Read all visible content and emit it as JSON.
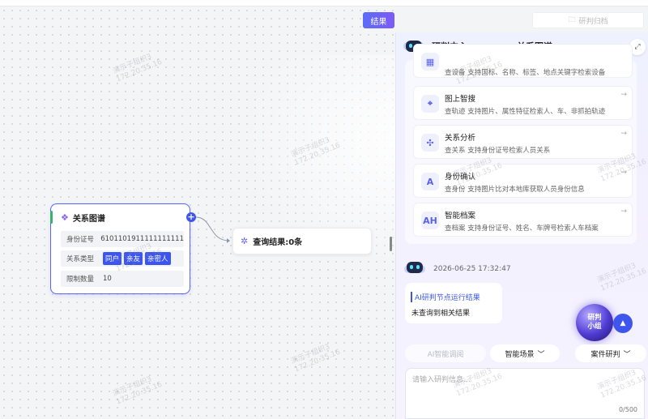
{
  "top": {
    "corner_text": ""
  },
  "toolbar": {
    "result_label": "结果",
    "archive_label": "研判归档",
    "archive_icon": "folder-icon"
  },
  "node": {
    "title": "关系图谱",
    "icon": "graph-icon",
    "rows": [
      {
        "label": "身份证号",
        "value": "6101101911111111111"
      },
      {
        "label": "关系类型",
        "tags": [
          "同户",
          "亲友",
          "亲密人"
        ]
      },
      {
        "label": "限制数量",
        "value": "10"
      }
    ],
    "plus": "+"
  },
  "result_node": {
    "label": "查询结果:0条"
  },
  "panel": {
    "tabs": [
      "研判中心",
      "关系图谱"
    ],
    "expand_icon": "expand-icon",
    "cards": [
      {
        "icon": "device-icon",
        "title": "",
        "desc": "查设备 支持国标、名称、标签、地点关键字检索设备",
        "glyph": "▦"
      },
      {
        "icon": "image-search-icon",
        "title": "图上智搜",
        "desc": "查轨迹 支持图片、属性特征检索人、车、非抓拍轨迹",
        "glyph": "⌖"
      },
      {
        "icon": "relation-icon",
        "title": "关系分析",
        "desc": "查关系 支持身份证号检索人员关系",
        "glyph": "✣"
      },
      {
        "icon": "identity-icon",
        "title": "身份确认",
        "desc": "查身份 支持图片比对本地库获取人员身份信息",
        "glyph": "A"
      },
      {
        "icon": "archive-icon",
        "title": "智能档案",
        "desc": "查档案 支持身份证号、姓名、车牌号检索人车档案",
        "glyph": "AH"
      }
    ],
    "message": {
      "time": "2026-06-25 17:32:47",
      "title": "AI研判节点运行结果",
      "text": "未查询到相关结果"
    },
    "orb": {
      "line1": "研判",
      "line2": "小组"
    },
    "chips": [
      {
        "label": "AI智能调阅",
        "disabled": true
      },
      {
        "label": "智能场景",
        "disabled": false
      },
      {
        "label": "案件研判",
        "disabled": false
      }
    ],
    "input": {
      "placeholder": "请输入研判信息...",
      "counter": "0/500"
    }
  },
  "watermark": {
    "line1": "演示子组织3",
    "line2": "172.20.35.16"
  }
}
